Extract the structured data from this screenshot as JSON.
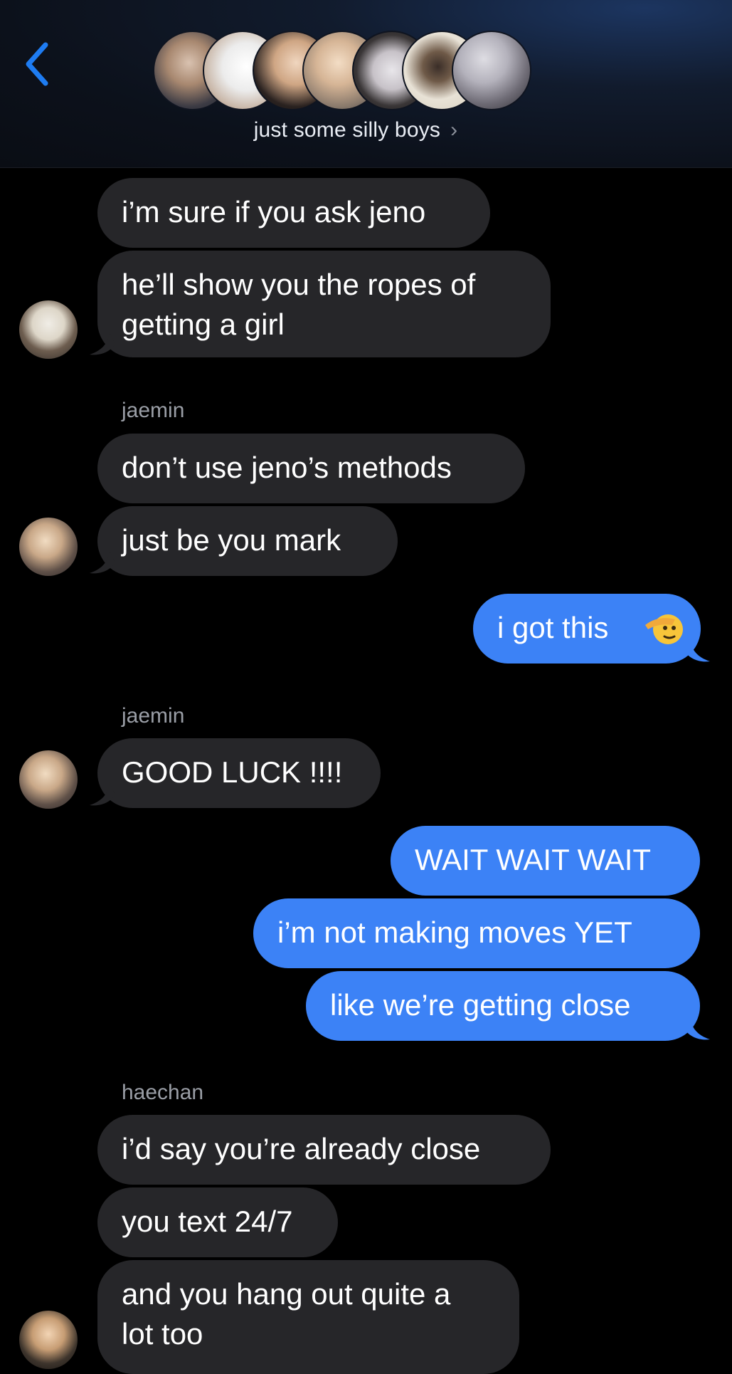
{
  "header": {
    "back_icon": "chevron-left-icon",
    "group_name": "just some silly boys",
    "chevron": "›",
    "accent_color": "#1e7cf2"
  },
  "messages": [
    {
      "type": "incoming",
      "text": "i’m sure if you ask jeno"
    },
    {
      "type": "incoming",
      "text_lines": [
        "he’ll show you the ropes of",
        "getting a girl"
      ]
    },
    {
      "type": "sender",
      "text": "jaemin"
    },
    {
      "type": "incoming",
      "text": "don’t use jeno’s methods"
    },
    {
      "type": "incoming",
      "text": "just be you mark"
    },
    {
      "type": "outgoing",
      "text": "i got this",
      "emoji": "saluting-face"
    },
    {
      "type": "sender",
      "text": "jaemin"
    },
    {
      "type": "incoming",
      "text": "GOOD LUCK !!!!"
    },
    {
      "type": "outgoing",
      "text": "WAIT WAIT WAIT"
    },
    {
      "type": "outgoing",
      "text": "i’m not making moves YET"
    },
    {
      "type": "outgoing",
      "text": "like we’re getting close"
    },
    {
      "type": "sender",
      "text": "haechan"
    },
    {
      "type": "incoming",
      "text": "i’d say you’re already close"
    },
    {
      "type": "incoming",
      "text": "you text 24/7"
    },
    {
      "type": "incoming",
      "text_lines": [
        "and you hang out quite a",
        "lot too"
      ]
    }
  ],
  "colors": {
    "incoming_bubble": "#262629",
    "outgoing_bubble": "#3c82f6",
    "background": "#000000",
    "sender_name": "#9a9ea6"
  }
}
